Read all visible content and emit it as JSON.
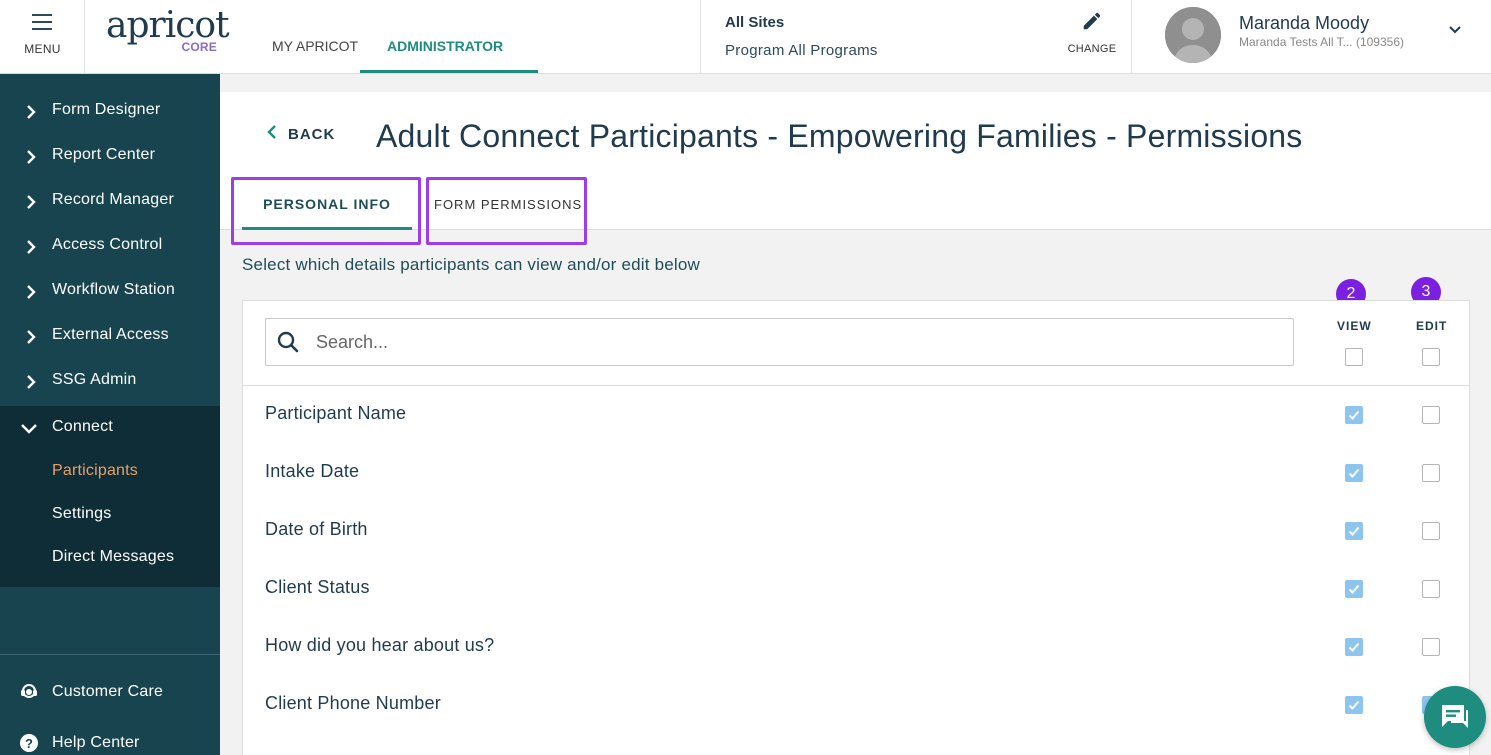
{
  "header": {
    "menu_label": "MENU",
    "logo_text": "apricot",
    "logo_sub": "CORE",
    "tabs": [
      {
        "label": "MY APRICOT"
      },
      {
        "label": "ADMINISTRATOR"
      }
    ],
    "sites_title": "All Sites",
    "sites_program": "Program All Programs",
    "change_label": "CHANGE",
    "user_name": "Maranda Moody",
    "user_sub": "Maranda Tests All T...  (109356)"
  },
  "sidebar": {
    "items": [
      {
        "label": "Form Designer"
      },
      {
        "label": "Report Center"
      },
      {
        "label": "Record Manager"
      },
      {
        "label": "Access Control"
      },
      {
        "label": "Workflow Station"
      },
      {
        "label": "External Access"
      },
      {
        "label": "SSG Admin"
      }
    ],
    "connect": {
      "label": "Connect",
      "subitems": [
        {
          "label": "Participants",
          "active": true
        },
        {
          "label": "Settings",
          "active": false
        },
        {
          "label": "Direct Messages",
          "active": false
        }
      ]
    },
    "bottom": [
      {
        "label": "Customer Care",
        "icon": "headset-icon"
      },
      {
        "label": "Help Center",
        "icon": "help-icon"
      }
    ]
  },
  "page": {
    "back_label": "BACK",
    "title": "Adult Connect Participants - Empowering Families - Permissions",
    "tabs": [
      {
        "label": "PERSONAL INFO",
        "active": true
      },
      {
        "label": "FORM PERMISSIONS",
        "active": false
      }
    ],
    "instruction": "Select which details participants can view and/or edit below",
    "badges": [
      "2",
      "3"
    ],
    "search_placeholder": "Search...",
    "columns": {
      "view": "VIEW",
      "edit": "EDIT"
    },
    "select_all": {
      "view": false,
      "edit": false
    },
    "rows": [
      {
        "label": "Participant Name",
        "view": true,
        "edit": false
      },
      {
        "label": "Intake Date",
        "view": true,
        "edit": false
      },
      {
        "label": "Date of Birth",
        "view": true,
        "edit": false
      },
      {
        "label": "Client Status",
        "view": true,
        "edit": false
      },
      {
        "label": "How did you hear about us?",
        "view": true,
        "edit": false
      },
      {
        "label": "Client Phone Number",
        "view": true,
        "edit": true
      }
    ]
  },
  "colors": {
    "accent": "#1e8c7f",
    "sidebar_bg": "#17444f",
    "sidebar_active_bg": "#0e2d36",
    "active_link": "#e8a06a",
    "highlight": "#9b3de8",
    "badge": "#7b1fe0",
    "checkbox_checked": "#8ec5ef"
  }
}
